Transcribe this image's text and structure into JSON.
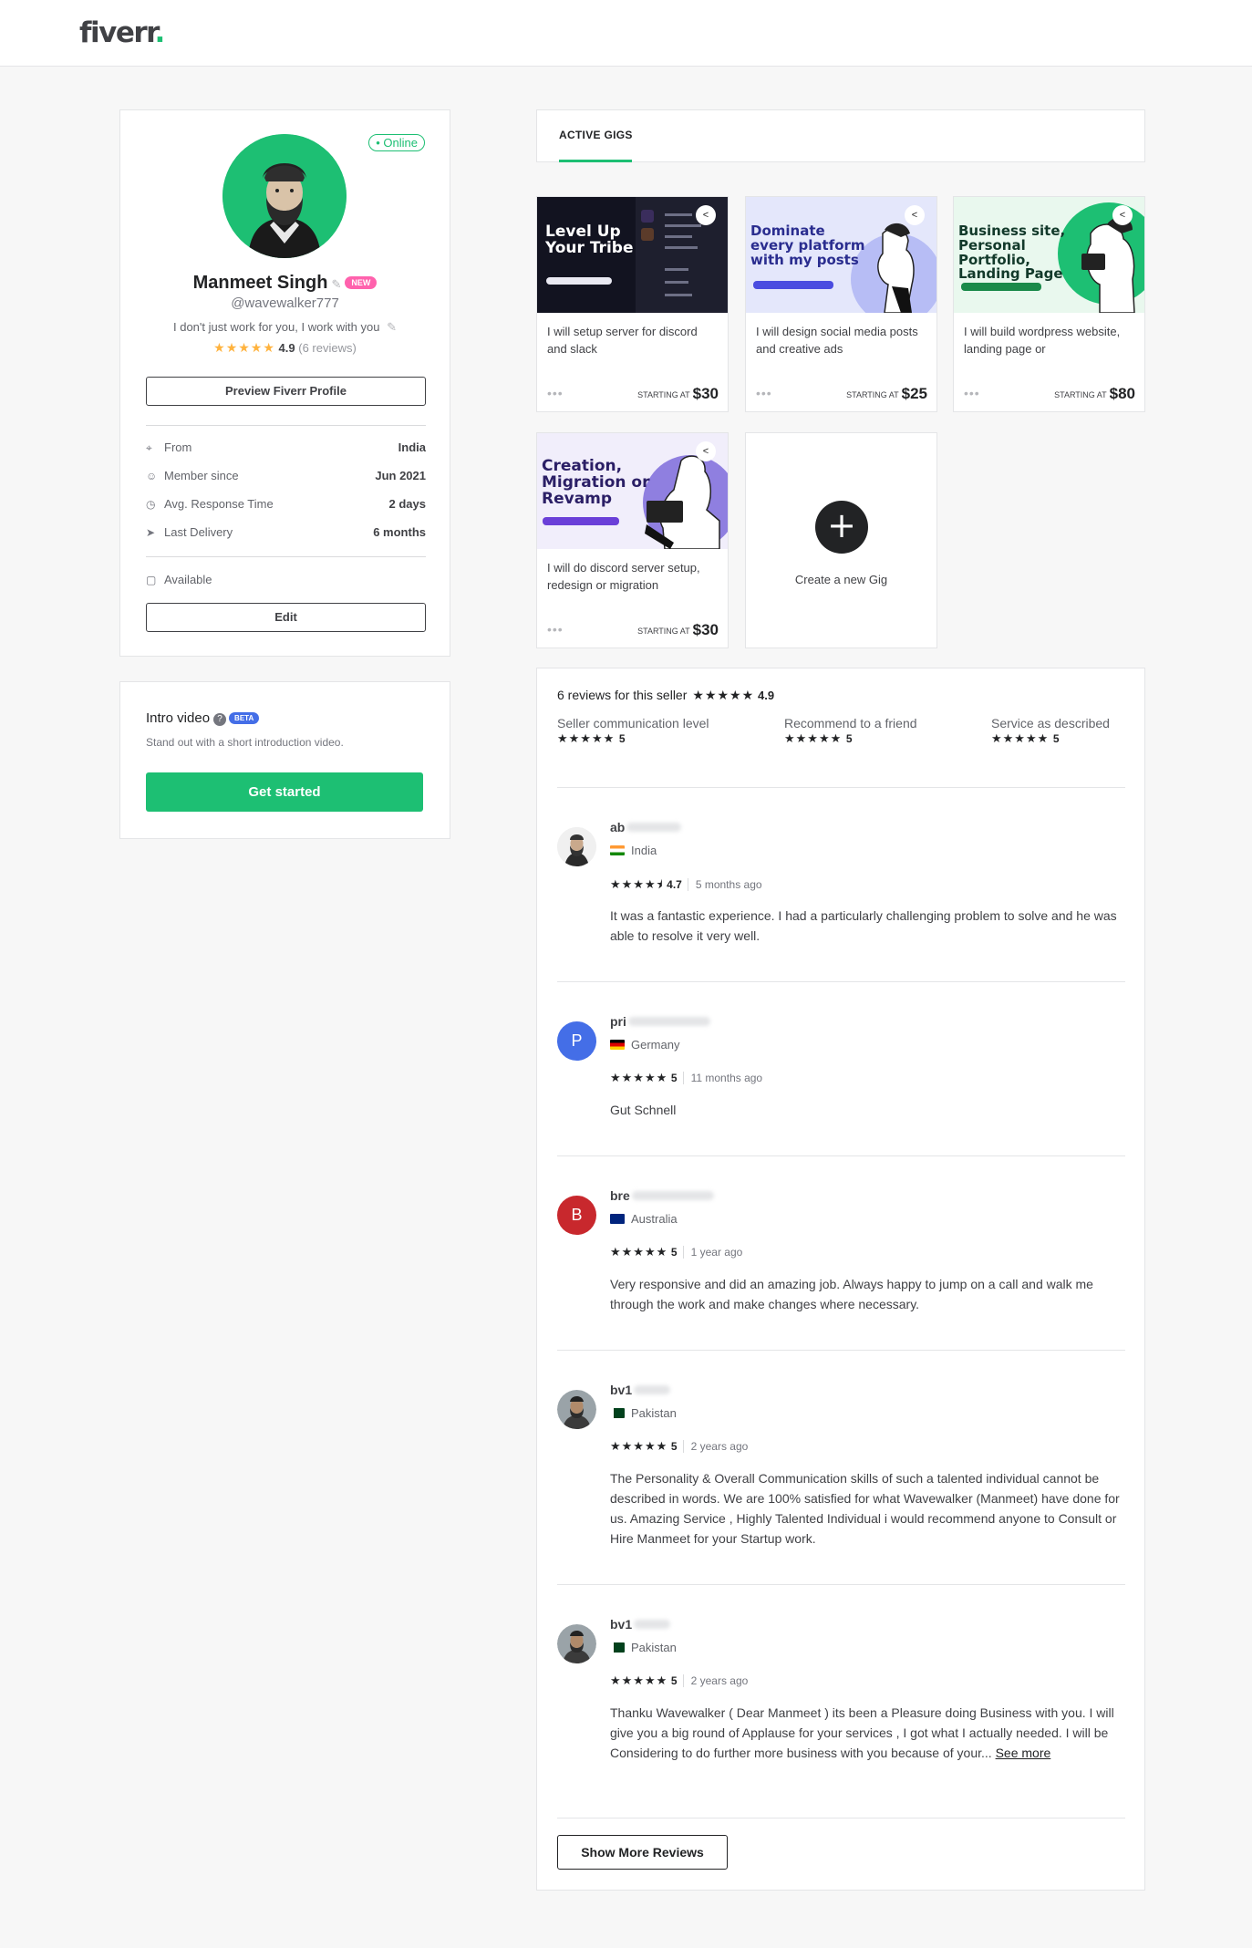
{
  "brand": {
    "logo": "fiverr",
    "accent": "#1dbf73"
  },
  "profile": {
    "status": "• Online",
    "name": "Manmeet Singh",
    "badge": "NEW",
    "handle": "@wavewalker777",
    "tagline": "I don't just work for you, I work with you",
    "rating": "4.9",
    "reviews_count": "(6 reviews)",
    "preview_button": "Preview Fiverr Profile",
    "info": [
      {
        "icon": "location-icon",
        "label": "From",
        "value": "India"
      },
      {
        "icon": "user-icon",
        "label": "Member since",
        "value": "Jun 2021"
      },
      {
        "icon": "clock-icon",
        "label": "Avg. Response Time",
        "value": "2 days"
      },
      {
        "icon": "send-icon",
        "label": "Last Delivery",
        "value": "6 months"
      }
    ],
    "availability": "Available",
    "edit_button": "Edit"
  },
  "intro": {
    "title": "Intro video",
    "badge": "BETA",
    "subtitle": "Stand out with a short introduction video.",
    "button": "Get started"
  },
  "tabs": {
    "active": "ACTIVE GIGS"
  },
  "gigs": [
    {
      "thumb_text": "Level Up\nYour Tribe",
      "title": "I will setup server for discord and slack",
      "starting": "STARTING AT",
      "price": "$30"
    },
    {
      "thumb_text": "Dominate every platform with my posts",
      "title": "I will design social media posts and creative ads",
      "starting": "STARTING AT",
      "price": "$25"
    },
    {
      "thumb_text": "Business site, Personal Portfolio, Landing Page",
      "title": "I will build wordpress website, landing page or",
      "starting": "STARTING AT",
      "price": "$80"
    },
    {
      "thumb_text": "Creation, Migration or Revamp",
      "title": "I will do discord server setup, redesign or migration",
      "starting": "STARTING AT",
      "price": "$30"
    }
  ],
  "create_gig": "Create a new Gig",
  "reviews": {
    "header": "6 reviews for this seller",
    "overall": "4.9",
    "subratings": [
      {
        "label": "Seller communication level",
        "value": "5"
      },
      {
        "label": "Recommend to a friend",
        "value": "5"
      },
      {
        "label": "Service as described",
        "value": "5"
      }
    ],
    "items": [
      {
        "initial": "",
        "name": "ab",
        "country": "India",
        "rating": "4.7",
        "ago": "5 months ago",
        "text": "It was a fantastic experience. I had a particularly challenging problem to solve and he was able to resolve it very well.",
        "more": ""
      },
      {
        "initial": "P",
        "name": "pri",
        "country": "Germany",
        "rating": "5",
        "ago": "11 months ago",
        "text": "Gut Schnell",
        "more": ""
      },
      {
        "initial": "B",
        "name": "bre",
        "country": "Australia",
        "rating": "5",
        "ago": "1 year ago",
        "text": "Very responsive and did an amazing job. Always happy to jump on a call and walk me through the work and make changes where necessary.",
        "more": ""
      },
      {
        "initial": "",
        "name": "bv1",
        "country": "Pakistan",
        "rating": "5",
        "ago": "2 years ago",
        "text": "The Personality & Overall Communication skills of such a talented individual cannot be described in words. We are 100% satisfied for what Wavewalker (Manmeet) have done for us. Amazing Service , Highly Talented Individual i would recommend anyone to Consult or Hire Manmeet for your Startup work.",
        "more": ""
      },
      {
        "initial": "",
        "name": "bv1",
        "country": "Pakistan",
        "rating": "5",
        "ago": "2 years ago",
        "text": "Thanku Wavewalker ( Dear Manmeet ) its been a Pleasure doing Business with you. I will give you a big round of Applause for your services , I got what I actually needed. I will be Considering to do further more business with you because of your...",
        "more": "See more"
      }
    ],
    "show_more": "Show More Reviews"
  }
}
